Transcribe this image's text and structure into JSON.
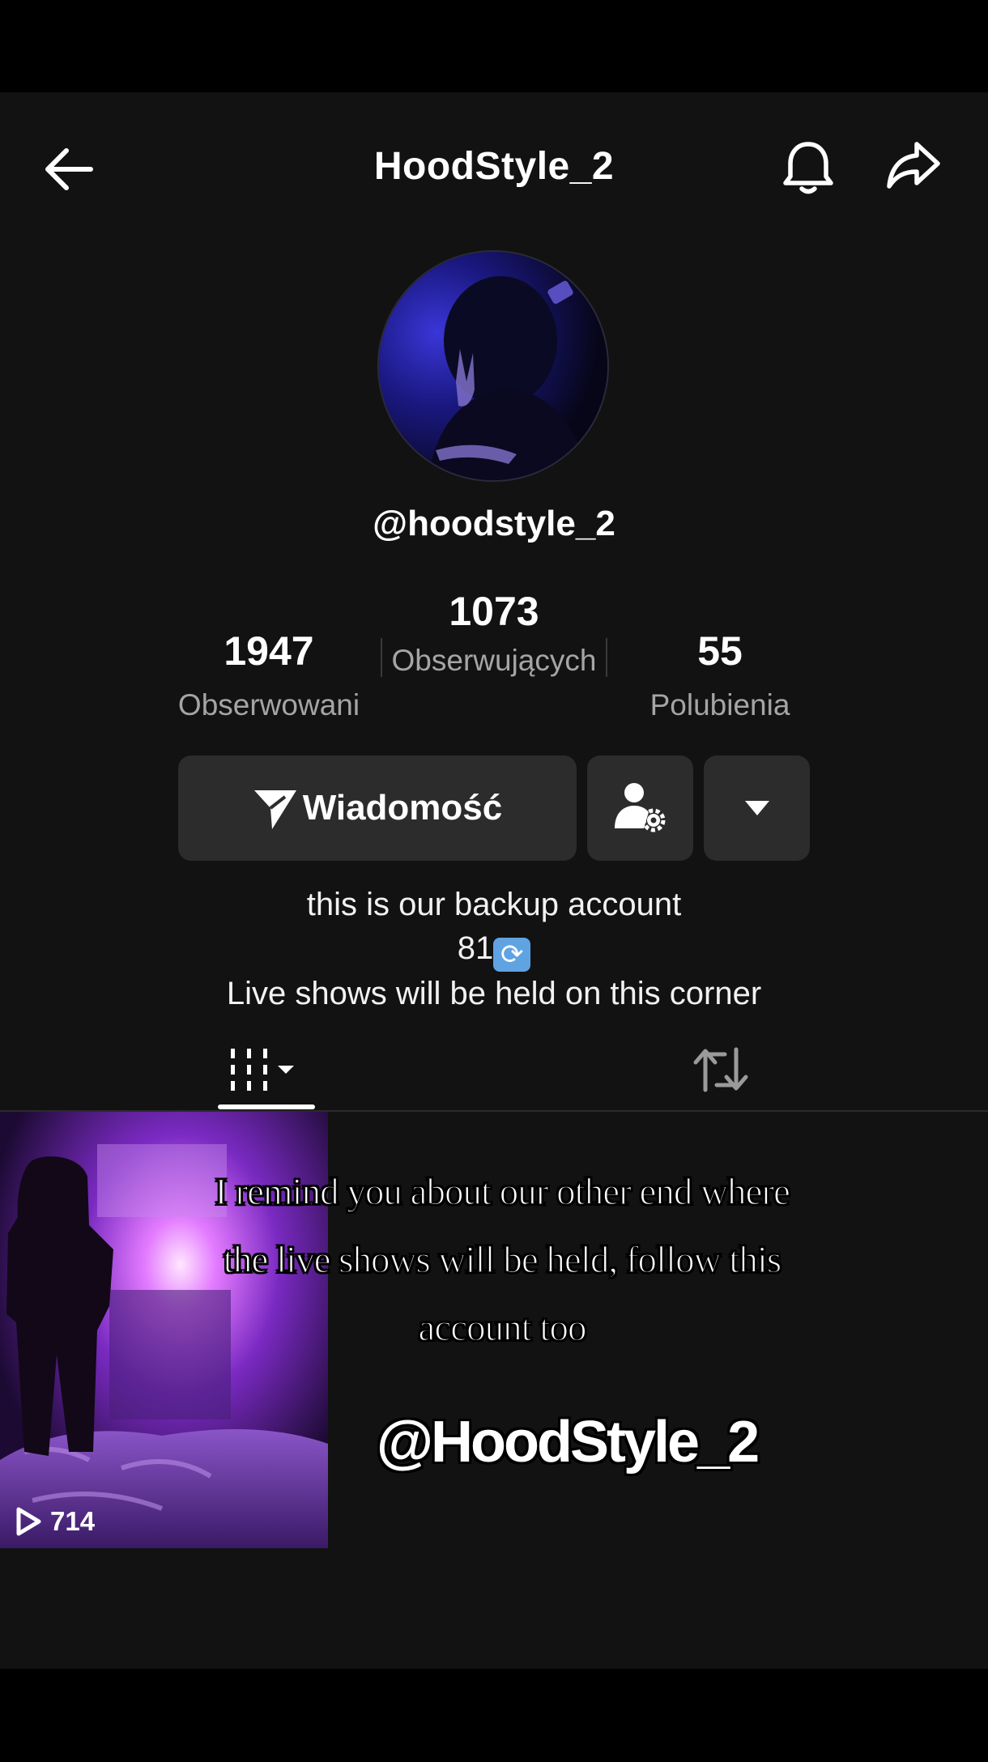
{
  "header": {
    "title": "HoodStyle_2",
    "back_icon": "arrow-left-icon",
    "bell_icon": "bell-icon",
    "share_icon": "share-icon"
  },
  "profile": {
    "handle": "@hoodstyle_2",
    "stats": [
      {
        "value": "1947",
        "label": "Obserwowani"
      },
      {
        "value": "1073",
        "label": "Obserwujących"
      },
      {
        "value": "55",
        "label": "Polubienia"
      }
    ],
    "message_button": "Wiadomość",
    "bio_line1": "this is our backup account",
    "bio_line2": "81",
    "bio_line3": "Live shows will be held on this corner"
  },
  "tabs": {
    "videos_icon": "grid-icon",
    "reposts_icon": "repost-icon"
  },
  "video": {
    "views": "714"
  },
  "overlay": {
    "line1": "I remind you about our other end where",
    "line2": "the live shows will be held, follow this",
    "line3": "account too",
    "handle": "@HoodStyle_2"
  },
  "colors": {
    "background": "#121212",
    "button": "#2c2c2c",
    "muted_text": "#a5a5a5"
  }
}
